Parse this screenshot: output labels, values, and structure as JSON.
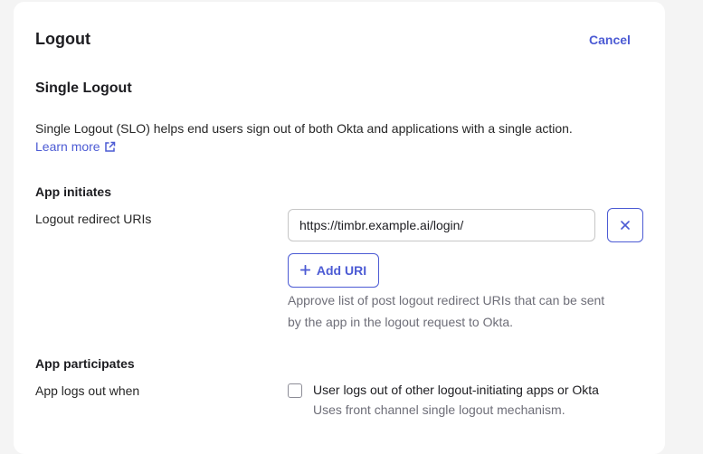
{
  "panel": {
    "title": "Logout",
    "cancel_label": "Cancel"
  },
  "single_logout": {
    "heading": "Single Logout",
    "description": "Single Logout (SLO) helps end users sign out of both Okta and applications with a single action.",
    "learn_more_label": "Learn more",
    "learn_more_icon": "external-link-icon"
  },
  "app_initiates": {
    "heading": "App initiates",
    "field_label": "Logout redirect URIs",
    "uris": [
      {
        "value": "https://timbr.example.ai/login/"
      }
    ],
    "remove_icon": "close-icon",
    "add_uri_label": "Add URI",
    "add_icon": "plus-icon",
    "help_text_line1": "Approve list of post logout redirect URIs that can be sent",
    "help_text_line2": "by the app in the logout request to Okta."
  },
  "app_participates": {
    "heading": "App participates",
    "field_label": "App logs out when",
    "option_label": "User logs out of other logout-initiating apps or Okta",
    "option_hint": "Uses front channel single logout mechanism.",
    "option_checked": false
  },
  "colors": {
    "accent": "#4c5bd4",
    "background": "#f4f4f4",
    "card": "#ffffff",
    "muted_text": "#6e6e78"
  }
}
